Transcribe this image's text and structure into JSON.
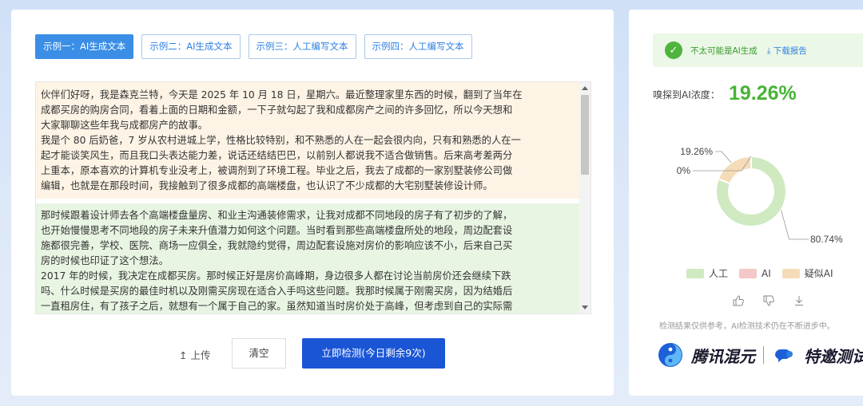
{
  "tabs": [
    {
      "label": "示例一：AI生成文本",
      "active": true
    },
    {
      "label": "示例二：AI生成文本",
      "active": false
    },
    {
      "label": "示例三：人工编写文本",
      "active": false
    },
    {
      "label": "示例四：人工编写文本",
      "active": false
    }
  ],
  "text": {
    "para1": [
      "伙伴们好呀，我是森克兰特，今天是 2025 年 10 月 18 日，星期六。最近整理家里东西的时候，翻到了当年在",
      "成都买房的购房合同，看着上面的日期和金额，一下子就勾起了我和成都房产之间的许多回忆，所以今天想和",
      "大家聊聊这些年我与成都房产的故事。",
      "我是个 80 后奶爸，7 岁从农村进城上学，性格比较特别，和不熟悉的人在一起会很内向，只有和熟悉的人在一",
      "起才能谈笑风生，而且我口头表达能力差，说话还结结巴巴，以前别人都说我不适合做销售。后来高考差两分",
      "上重本，原本喜欢的计算机专业没考上，被调剂到了环境工程。毕业之后，我去了成都的一家别墅装修公司做",
      "编辑，也就是在那段时间，我接触到了很多成都的高端楼盘，也认识了不少成都的大宅别墅装修设计师。"
    ],
    "para2": [
      "那时候跟着设计师去各个高端楼盘量房、和业主沟通装修需求，让我对成都不同地段的房子有了初步的了解，",
      "也开始慢慢思考不同地段的房子未来升值潜力如何这个问题。当时看到那些高端楼盘所处的地段，周边配套设",
      "施都很完善，学校、医院、商场一应俱全，我就隐约觉得，周边配套设施对房价的影响应该不小，后来自己买",
      "房的时候也印证了这个想法。",
      "2017 年的时候，我决定在成都买房。那时候正好是房价高峰期，身边很多人都在讨论当前房价还会继续下跌",
      "吗、什么时候是买房的最佳时机以及刚需买房现在适合入手吗这些问题。我那时候属于刚需买房，因为结婚后",
      "一直租房住，有了孩子之后，就想有一个属于自己的家。虽然知道当时房价处于高峰，但考虑到自己的实际需"
    ]
  },
  "actions": {
    "upload": "上传",
    "clear": "清空",
    "detect": "立即检测(今日剩余9次)"
  },
  "result": {
    "verdict": "不太可能是AI生成",
    "download": "下载报告",
    "concentration_label": "嗅探到AI浓度：",
    "concentration_value": "19.26%",
    "legend": [
      "人工",
      "AI",
      "疑似AI"
    ],
    "disclaimer": "检测结果仅供参考，AI检测技术仍在不断进步中。",
    "brand1": "腾讯混元",
    "brand2": "特邀测试"
  },
  "chart_data": {
    "type": "pie",
    "categories": [
      "人工",
      "AI",
      "疑似AI"
    ],
    "values": [
      80.74,
      0,
      19.26
    ],
    "value_labels": [
      "80.74%",
      "0%",
      "19.26%"
    ],
    "colors": [
      "#cfe9c1",
      "#f4c7c9",
      "#f5dcb8"
    ],
    "donut": true
  }
}
